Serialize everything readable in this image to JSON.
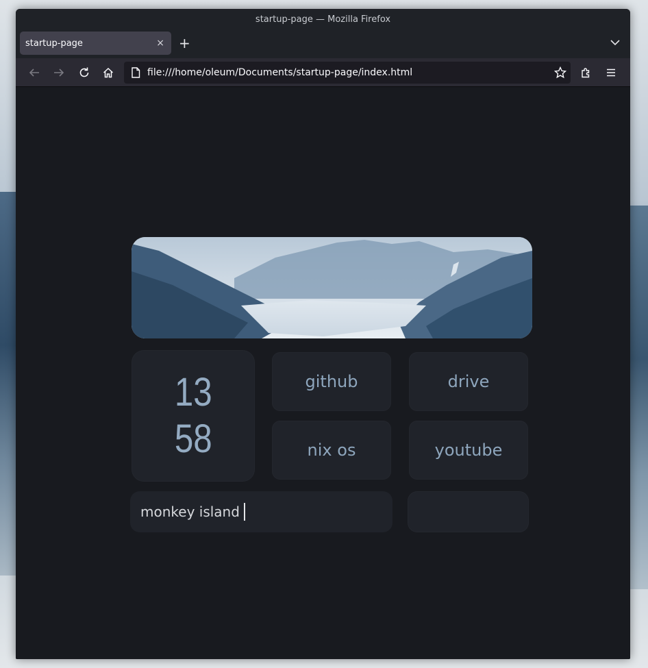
{
  "window": {
    "title": "startup-page — Mozilla Firefox"
  },
  "tab": {
    "title": "startup-page",
    "close": "×"
  },
  "toolbar": {
    "new_tab": "+"
  },
  "urlbar": {
    "url": "file:///home/oleum/Documents/startup-page/index.html"
  },
  "clock": {
    "hours": "13",
    "minutes": "58"
  },
  "links": [
    {
      "label": "github"
    },
    {
      "label": "drive"
    },
    {
      "label": "nix os"
    },
    {
      "label": "youtube"
    }
  ],
  "search": {
    "value": "monkey island"
  },
  "colors": {
    "page_bg": "#181a1f",
    "tile_bg": "#20232a",
    "accent_text": "#8ea6bd"
  }
}
